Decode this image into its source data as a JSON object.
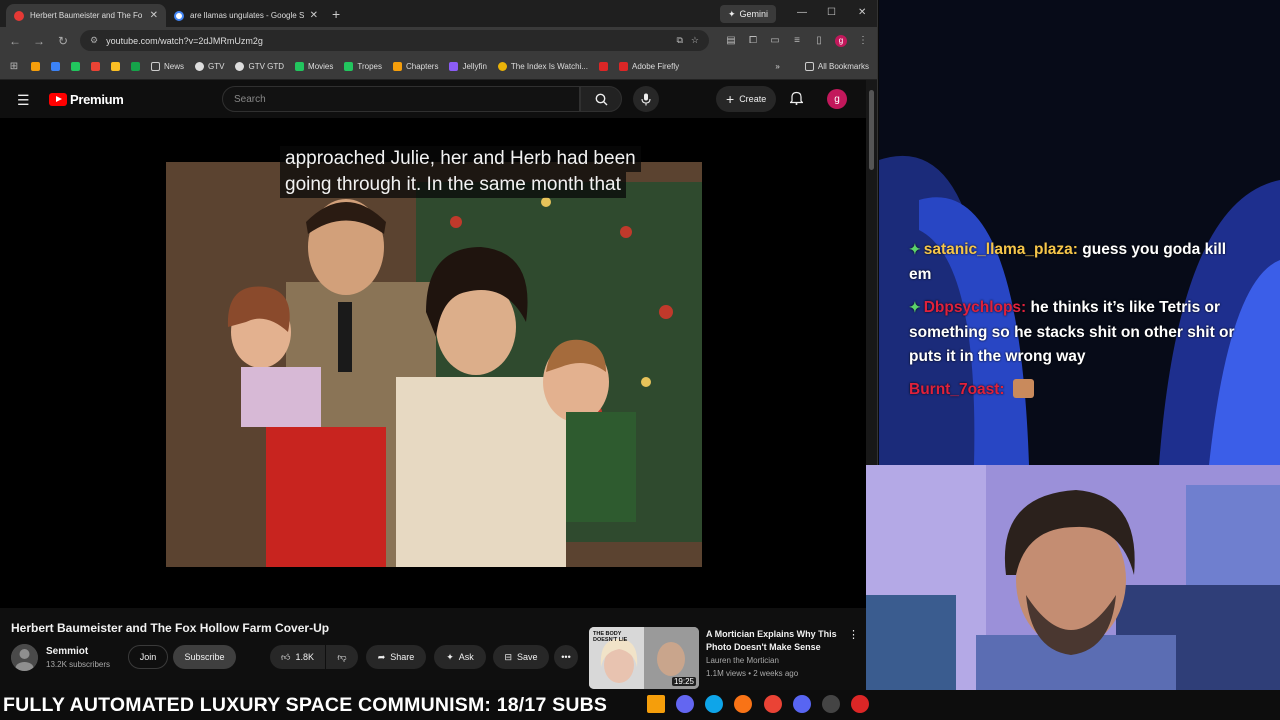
{
  "browser": {
    "tabs": [
      {
        "title": "Herbert Baumeister and The Fo",
        "close": "✕",
        "active": true
      },
      {
        "title": "are llamas ungulates - Google S",
        "close": "✕",
        "active": false
      }
    ],
    "new_tab": "+",
    "gemini_label": "Gemini",
    "window_controls": {
      "minimize": "—",
      "maximize": "☐",
      "close": "✕"
    },
    "url": "youtube.com/watch?v=2dJMRmUzm2g",
    "profile_initial": "g",
    "bookmarks": [
      "News",
      "GTV",
      "GTV GTD",
      "Movies",
      "Tropes",
      "Chapters",
      "Jellyfin",
      "The Index Is Watchi...",
      "Adobe Firefly"
    ],
    "all_bookmarks": "All Bookmarks",
    "overflow": "»"
  },
  "youtube": {
    "logo_text": "Premium",
    "search_placeholder": "Search",
    "create_label": "Create",
    "avatar_initial": "g",
    "caption_lines": [
      "approached Julie, her and Herb had been",
      "going through it. In the same month that"
    ],
    "video_title": "Herbert Baumeister and The Fox Hollow Farm Cover-Up",
    "channel_name": "Semmiot",
    "subscribers": "13.2K subscribers",
    "join_label": "Join",
    "subscribe_label": "Subscribe",
    "likes": "1.8K",
    "share_label": "Share",
    "ask_label": "Ask",
    "save_label": "Save",
    "more_label": "•••",
    "recommendation": {
      "title": "A Mortician Explains Why This Photo Doesn't Make Sense",
      "channel": "Lauren the Mortician",
      "meta": "1.1M views • 2 weeks ago",
      "duration": "19:25",
      "thumb_text": "THE BODY DOESN'T LIE"
    }
  },
  "chat": [
    {
      "user": "satanic_llama_plaza:",
      "text": "guess you goda kill em",
      "color": "#f6c64a",
      "badge": true
    },
    {
      "user": "Dbpsychlops:",
      "text": "he thinks it’s like Tetris or something so he stacks shit on other shit or puts it in the wrong way",
      "color": "#e0213c",
      "badge": true
    },
    {
      "user": "Burnt_7oast:",
      "text": "",
      "color": "#e0213c",
      "badge": false,
      "emote": true
    }
  ],
  "ticker": "FULLY AUTOMATED LUXURY SPACE COMMUNISM: 18/17 SUBS"
}
